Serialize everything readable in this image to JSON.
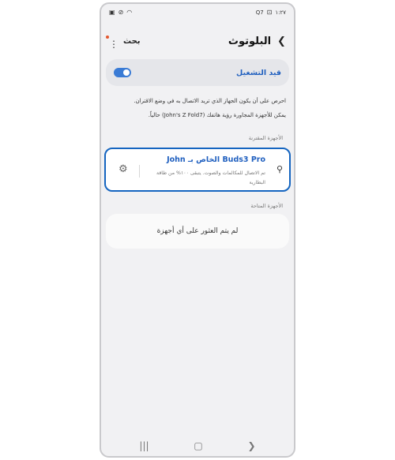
{
  "status_bar": {
    "time": "١:٢٧",
    "left_icons": [
      "gallery-icon",
      "no-disturb-icon",
      "wifi-icon"
    ],
    "right_icons": [
      "battery-icon",
      "screen-record-icon",
      "signal-icon"
    ],
    "right_text": "Q7"
  },
  "header": {
    "title": "البلوتوث",
    "search_label": "بحث",
    "accent_dot_color": "#e4572e"
  },
  "toggle": {
    "label": "قيد التشغيل",
    "on": true,
    "color": "#3a7bd5"
  },
  "info": {
    "line1": "احرص على أن يكون الجهاز الذي تريد الاتصال به في وضع الاقتران.",
    "line2": "يمكن للأجهزة المجاورة رؤية هاتفك (John's Z Fold7) حالياً."
  },
  "paired_section": {
    "label": "الأجهزة المقترنة",
    "device": {
      "name": "Buds3 Pro الخاص بـ John",
      "status": "تم الاتصال للمكالمات والصوت. يتبقى ١٠٠% من طاقة البطارية"
    }
  },
  "available_section": {
    "label": "الأجهزة المتاحة",
    "empty_text": "لم يتم العثور على أي أجهزة"
  }
}
